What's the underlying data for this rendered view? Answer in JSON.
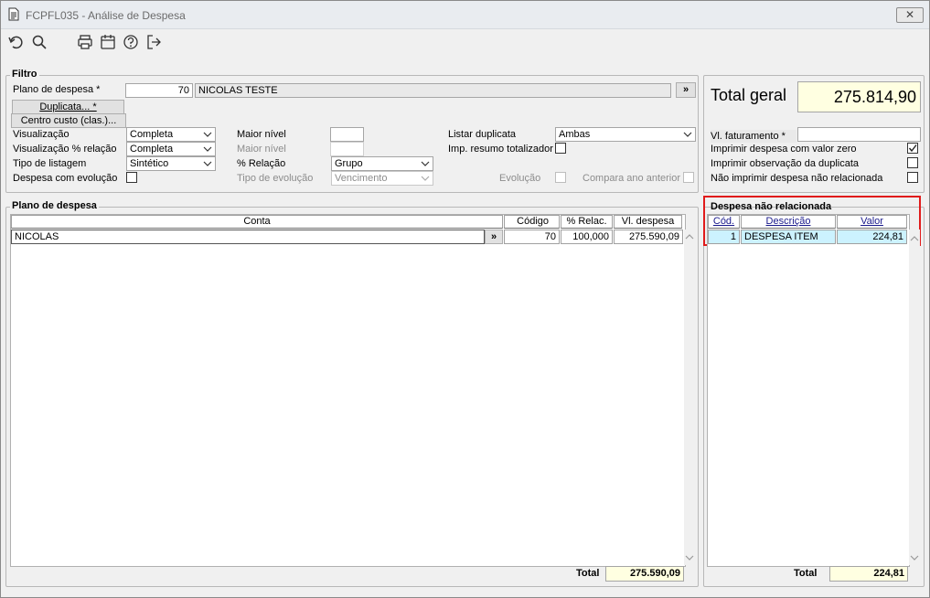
{
  "window": {
    "title": "FCPFL035 - Análise de Despesa",
    "close": "✕"
  },
  "filtro": {
    "legend": "Filtro",
    "plano_label": "Plano de despesa *",
    "plano_code": "70",
    "plano_name": "NICOLAS TESTE",
    "plano_btn": "»",
    "duplicata_btn": "Duplicata... *",
    "centro_btn": "Centro custo (clas.)...",
    "visualizacao_label": "Visualização",
    "visualizacao_value": "Completa",
    "visualizacao_rel_label": "Visualização % relação",
    "visualizacao_rel_value": "Completa",
    "tipo_listagem_label": "Tipo de listagem",
    "tipo_listagem_value": "Sintético",
    "despesa_evolucao_label": "Despesa com evolução",
    "maior_nivel_label": "Maior nível",
    "maior_nivel2_label": "Maior nível",
    "relacao_label": "% Relação",
    "relacao_value": "Grupo",
    "tipo_evolucao_label": "Tipo de evolução",
    "tipo_evolucao_value": "Vencimento",
    "listar_dup_label": "Listar duplicata",
    "listar_dup_value": "Ambas",
    "imp_resumo_label": "Imp. resumo totalizador",
    "evolucao_label": "Evolução",
    "compara_label": "Compara ano anterior"
  },
  "totals_panel": {
    "total_geral_label": "Total geral",
    "total_geral_value": "275.814,90",
    "vl_fat_label": "Vl. faturamento *",
    "opt1": "Imprimir despesa com valor zero",
    "opt2": "Imprimir observação da duplicata",
    "opt3": "Não imprimir despesa não relacionada"
  },
  "plano_grid": {
    "legend": "Plano de despesa",
    "headers": [
      "Conta",
      "Código",
      "% Relac.",
      "Vl. despesa"
    ],
    "row": {
      "conta": "NICOLAS",
      "btn": "»",
      "codigo": "70",
      "relac": "100,000",
      "valor": "275.590,09"
    },
    "total_label": "Total",
    "total_value": "275.590,09"
  },
  "nao_rel": {
    "legend": "Despesa não relacionada",
    "headers": [
      "Cód.",
      "Descrição",
      "Valor"
    ],
    "row": {
      "cod": "1",
      "desc": "DESPESA ITEM",
      "valor": "224,81"
    },
    "total_label": "Total",
    "total_value": "224,81"
  },
  "colors": {
    "highlight": "#e01b1b",
    "selection": "#ccf2ff",
    "total_bg": "#ffffe1"
  }
}
